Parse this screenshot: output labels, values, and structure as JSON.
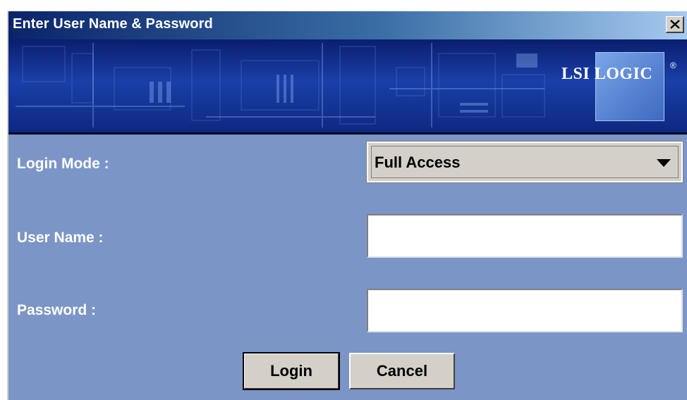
{
  "window": {
    "title": "Enter User Name & Password",
    "close_icon": "close-icon"
  },
  "banner": {
    "logo_text": "LSI LOGIC",
    "logo_registered": "®",
    "background_icon": "circuit-board-image"
  },
  "form": {
    "login_mode": {
      "label": "Login Mode :",
      "selected": "Full Access",
      "arrow_icon": "dropdown-arrow-icon"
    },
    "user_name": {
      "label": "User Name :",
      "value": ""
    },
    "password": {
      "label": "Password :",
      "value": ""
    }
  },
  "buttons": {
    "login": "Login",
    "cancel": "Cancel"
  },
  "colors": {
    "dialog_background": "#7b95c6",
    "title_bar_start": "#0a246a",
    "title_bar_end": "#a6caf0",
    "button_face": "#d4d0c8"
  }
}
